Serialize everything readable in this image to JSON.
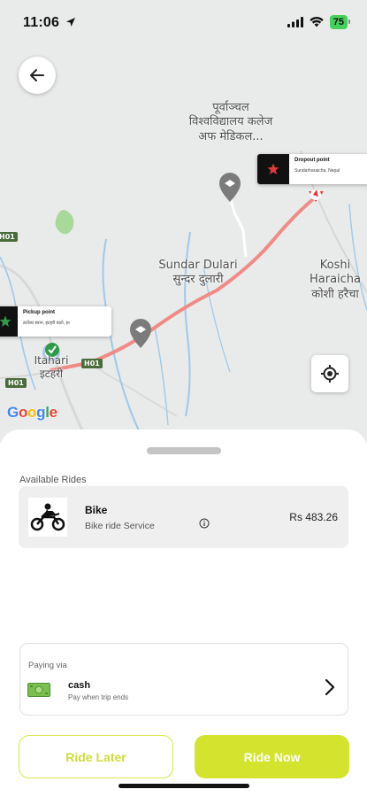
{
  "status_bar": {
    "time": "11:06",
    "battery": "75"
  },
  "map": {
    "labels": {
      "college": "पूर्वाञ्चल विश्वविद्यालय कलेज अफ मेडिकल...",
      "sundar": "Sundar Dulari सुन्दर दुलारी",
      "koshi": "Koshi Haraicha कोशी हरैचा",
      "itahari": "Itahari इटहरी"
    },
    "road_tags": [
      "H01",
      "H01",
      "H01"
    ],
    "pickup": {
      "title": "Pickup point",
      "address": "ठाउँका स्थान, इटहरी बाटो, इ०"
    },
    "dropoff": {
      "title": "Dropout point",
      "address": "Sundarharaicha, Nepal"
    },
    "google_logo": [
      "G",
      "o",
      "o",
      "g",
      "l",
      "e"
    ],
    "colors": {
      "route": "#f08a86",
      "water": "#9ec9ea",
      "park": "#a8d89a"
    }
  },
  "sheet": {
    "section_title": "Available Rides",
    "ride": {
      "name": "Bike",
      "description": "Bike ride Service",
      "price": "Rs 483.26"
    },
    "payment": {
      "label": "Paying via",
      "method": "cash",
      "note": "Pay when trip ends"
    },
    "buttons": {
      "later": "Ride Later",
      "now": "Ride Now"
    },
    "colors": {
      "accent": "#d4e42e",
      "accent_text": "#cddc36"
    }
  }
}
